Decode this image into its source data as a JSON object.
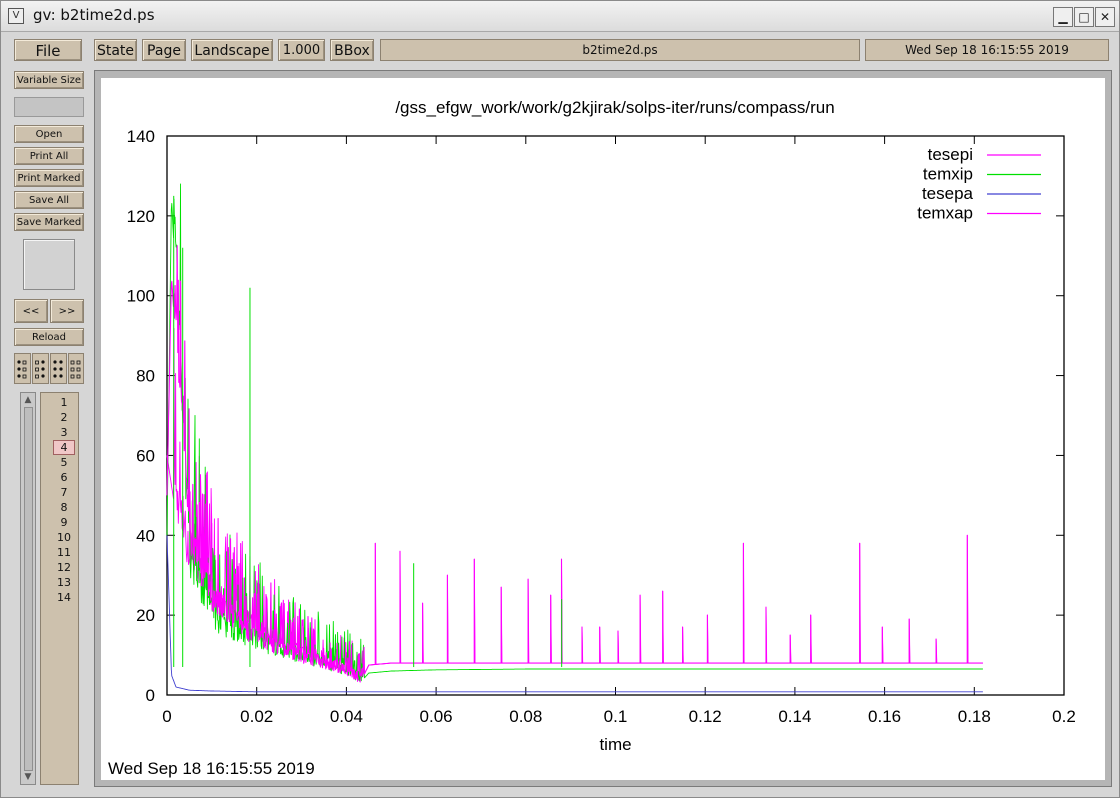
{
  "window": {
    "title": "gv: b2time2d.ps",
    "min_glyph": "▁",
    "max_glyph": "□",
    "close_glyph": "✕",
    "icon_glyph": "V"
  },
  "toolbar": {
    "file": "File",
    "state": "State",
    "page": "Page",
    "orientation": "Landscape",
    "scale": "1.000",
    "bbox": "BBox",
    "filename": "b2time2d.ps",
    "date": "Wed Sep 18 16:15:55 2019"
  },
  "sidebar": {
    "variable_size": "Variable Size",
    "open": "Open",
    "print_all": "Print All",
    "print_marked": "Print Marked",
    "save_all": "Save All",
    "save_marked": "Save Marked",
    "prev": "<<",
    "next": ">>",
    "reload": "Reload",
    "pages": [
      "1",
      "2",
      "3",
      "4",
      "5",
      "6",
      "7",
      "8",
      "9",
      "10",
      "11",
      "12",
      "13",
      "14"
    ],
    "current_page": "4"
  },
  "plot": {
    "title": "/gss_efgw_work/work/g2kjirak/solps-iter/runs/compass/run",
    "footer": "Wed Sep 18 16:15:55 2019"
  },
  "chart_data": {
    "type": "line",
    "title": "/gss_efgw_work/work/g2kjirak/solps-iter/runs/compass/run",
    "xlabel": "time",
    "ylabel": "",
    "xlim": [
      0,
      0.2
    ],
    "ylim": [
      0,
      140
    ],
    "x_ticks": [
      "0",
      "0.02",
      "0.04",
      "0.06",
      "0.08",
      "0.1",
      "0.12",
      "0.14",
      "0.16",
      "0.18",
      "0.2"
    ],
    "y_ticks": [
      "0",
      "20",
      "40",
      "60",
      "80",
      "100",
      "120",
      "140"
    ],
    "legend_position": "top-right",
    "series": [
      {
        "name": "tesepi",
        "color": "#ff00ff",
        "x": [
          0,
          0.002,
          0.005,
          0.01,
          0.02,
          0.03,
          0.04,
          0.043,
          0.045,
          0.05,
          0.06,
          0.08,
          0.1,
          0.12,
          0.14,
          0.16,
          0.18,
          0.182
        ],
        "y": [
          60,
          45,
          30,
          22,
          14,
          9,
          5,
          3,
          7.5,
          8,
          8,
          8,
          8,
          8,
          8,
          8,
          8,
          8
        ]
      },
      {
        "name": "temxip",
        "color": "#00e000",
        "x": [
          0,
          0.001,
          0.005,
          0.01,
          0.02,
          0.03,
          0.04,
          0.043,
          0.045,
          0.05,
          0.06,
          0.08,
          0.1,
          0.12,
          0.14,
          0.16,
          0.18,
          0.182
        ],
        "y": [
          40,
          125,
          30,
          16,
          11,
          8,
          5,
          3,
          5.5,
          6,
          6.3,
          6.5,
          6.5,
          6.5,
          6.5,
          6.5,
          6.5,
          6.5
        ]
      },
      {
        "name": "tesepa",
        "color": "#4040d0",
        "x": [
          0,
          0.001,
          0.002,
          0.005,
          0.01,
          0.02,
          0.04,
          0.06,
          0.1,
          0.14,
          0.18,
          0.182
        ],
        "y": [
          40,
          5,
          2,
          1.2,
          1,
          0.8,
          0.8,
          0.8,
          0.8,
          0.8,
          0.8,
          0.8
        ]
      },
      {
        "name": "temxap",
        "color": "#ff00ff",
        "x": [
          0,
          0.001,
          0.005,
          0.01,
          0.02,
          0.03,
          0.04,
          0.043,
          0.045,
          0.05,
          0.06,
          0.08,
          0.1,
          0.12,
          0.14,
          0.16,
          0.18,
          0.182
        ],
        "y": [
          50,
          105,
          35,
          20,
          12,
          8,
          5,
          3,
          7.5,
          8,
          8,
          8,
          8,
          8,
          8,
          8,
          8,
          8
        ]
      }
    ],
    "spikes": {
      "x": [
        0.0465,
        0.052,
        0.057,
        0.0625,
        0.0685,
        0.0745,
        0.0805,
        0.0855,
        0.088,
        0.0925,
        0.0965,
        0.1005,
        0.1055,
        0.1105,
        0.115,
        0.1205,
        0.1285,
        0.1335,
        0.139,
        0.1435,
        0.1545,
        0.1595,
        0.1655,
        0.1715,
        0.1785
      ],
      "y": [
        38,
        36,
        23,
        30,
        34,
        27,
        29,
        25,
        34,
        17,
        17,
        16,
        25,
        26,
        17,
        20,
        38,
        22,
        15,
        20,
        38,
        17,
        19,
        14,
        40
      ]
    }
  }
}
